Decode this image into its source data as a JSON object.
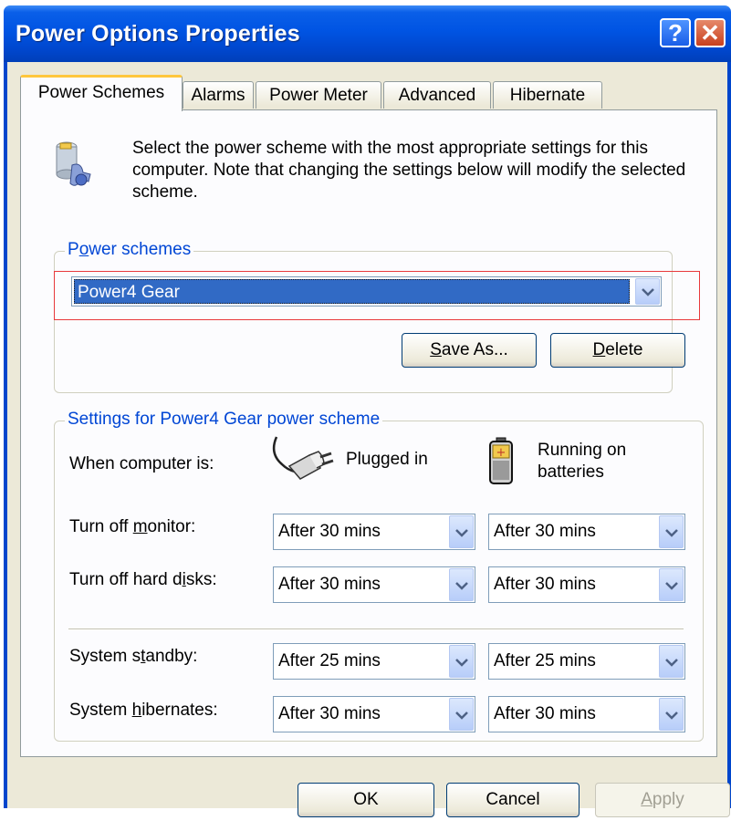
{
  "window": {
    "title": "Power Options Properties",
    "help_glyph": "?",
    "close_glyph": "✕"
  },
  "tabs": [
    {
      "label": "Power Schemes",
      "active": true
    },
    {
      "label": "Alarms",
      "active": false
    },
    {
      "label": "Power Meter",
      "active": false
    },
    {
      "label": "Advanced",
      "active": false
    },
    {
      "label": "Hibernate",
      "active": false
    }
  ],
  "intro": {
    "text": "Select the power scheme with the most appropriate settings for this computer. Note that changing the settings below will modify the selected scheme.",
    "icon": "power-scheme-icon"
  },
  "schemes_group": {
    "label_pre": "P",
    "label_ul": "o",
    "label_post": "wer schemes",
    "selected": "Power4 Gear",
    "save_as": {
      "ul": "S",
      "rest": "ave As..."
    },
    "delete": {
      "ul": "D",
      "rest": "elete"
    }
  },
  "settings_group": {
    "label": "Settings for Power4 Gear power scheme",
    "when_label": "When computer is:",
    "plugged_label": "Plugged in",
    "battery_label_1": "Running on",
    "battery_label_2": "batteries",
    "rows": [
      {
        "label_pre": "Turn off ",
        "label_ul": "m",
        "label_post": "onitor:",
        "plugged": "After 30 mins",
        "battery": "After 30 mins"
      },
      {
        "label_pre": "Turn off hard d",
        "label_ul": "i",
        "label_post": "sks:",
        "plugged": "After 30 mins",
        "battery": "After 30 mins"
      },
      {
        "label_pre": "System s",
        "label_ul": "t",
        "label_post": "andby:",
        "plugged": "After 25 mins",
        "battery": "After 25 mins"
      },
      {
        "label_pre": "System ",
        "label_ul": "h",
        "label_post": "ibernates:",
        "plugged": "After 30 mins",
        "battery": "After 30 mins"
      }
    ]
  },
  "footer": {
    "ok": "OK",
    "cancel": "Cancel",
    "apply": {
      "ul": "A",
      "rest": "pply"
    }
  },
  "colors": {
    "titlebar": "#0054e3",
    "group_label": "#0046d5",
    "selection": "#316ac5",
    "highlight_box": "#e8393b"
  }
}
